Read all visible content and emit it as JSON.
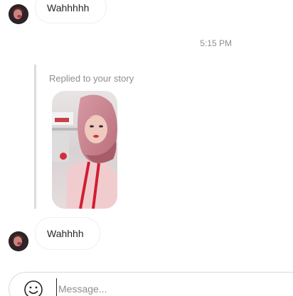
{
  "messages": [
    {
      "text": "Wahhhhh"
    },
    {
      "text": "Wahhhh"
    }
  ],
  "timestamp": "5:15 PM",
  "story_reply": {
    "label": "Replied to your story"
  },
  "composer": {
    "placeholder": "Message...",
    "emoji_icon": "smiley-icon"
  },
  "colors": {
    "bubble_border": "#efefef",
    "muted_text": "#8e8e8e",
    "reply_bar": "#dbdbdb"
  }
}
